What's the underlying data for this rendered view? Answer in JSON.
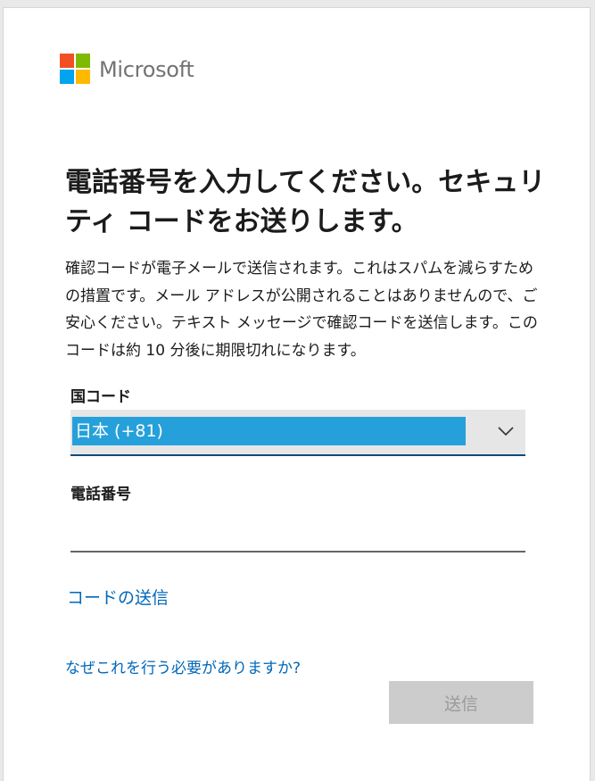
{
  "brand": {
    "name": "Microsoft",
    "logo_colors": [
      "#f25022",
      "#7fba00",
      "#00a4ef",
      "#ffb900"
    ]
  },
  "page": {
    "title": "電話番号を入力してください。セキュリティ コードをお送りします。",
    "description": "確認コードが電子メールで送信されます。これはスパムを減らすための措置です。メール アドレスが公開されることはありませんので、ご安心ください。テキスト メッセージで確認コードを送信します。このコードは約 10 分後に期限切れになります。"
  },
  "form": {
    "country_code_label": "国コード",
    "country_code_value": "日本 (+81)",
    "phone_label": "電話番号",
    "phone_value": "",
    "send_code_link": "コードの送信",
    "why_link": "なぜこれを行う必要がありますか?",
    "submit_label": "送信"
  },
  "colors": {
    "accent": "#0067b8",
    "selection": "#26a0da",
    "disabled_button": "#cccccc"
  },
  "icons": {
    "dropdown": "chevron-down-icon"
  }
}
